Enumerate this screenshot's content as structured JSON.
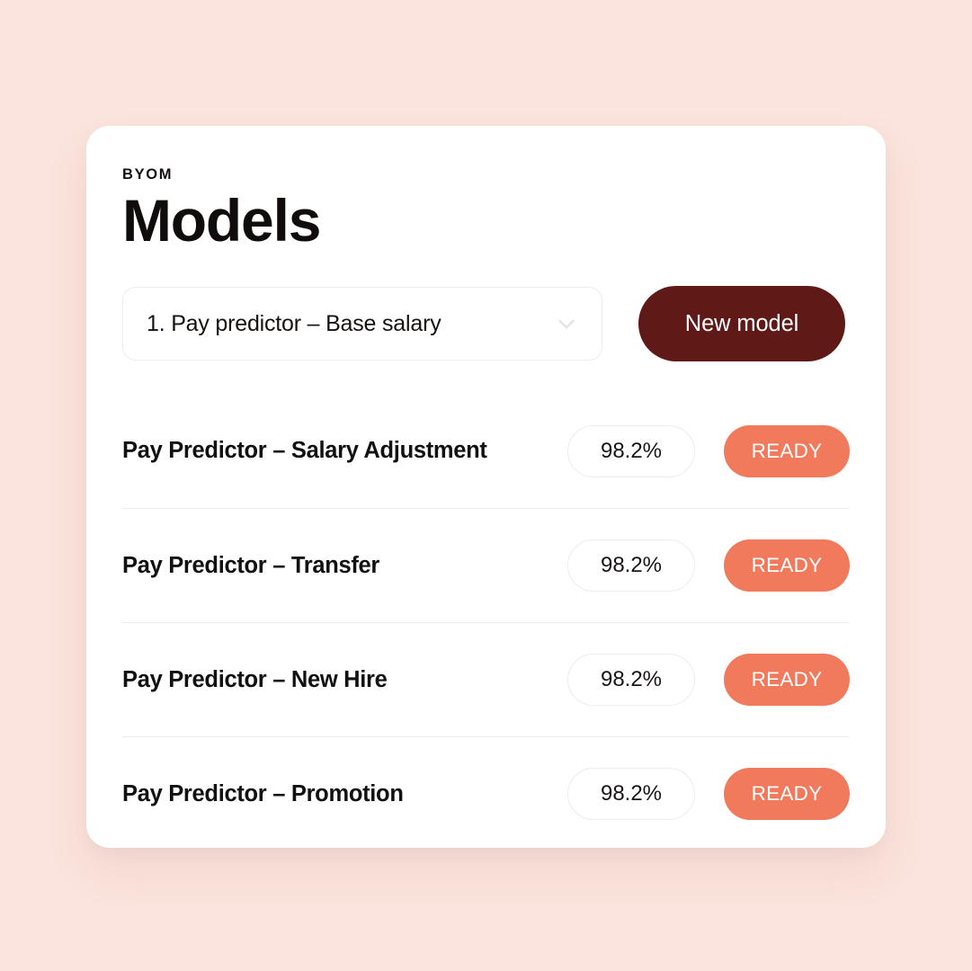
{
  "theme": {
    "page_background": "#FBE4DD",
    "card_background": "#FFFFFF",
    "primary_button": "#5F1A18",
    "status_ready": "#F1795C",
    "text_primary": "#131010",
    "divider": "#EFEFEF"
  },
  "card": {
    "eyebrow": "BYOM",
    "title": "Models"
  },
  "controls": {
    "model_select": {
      "value": "1. Pay predictor – Base salary",
      "icon": "chevron-down-icon"
    },
    "new_model_label": "New model"
  },
  "models": [
    {
      "name": "Pay Predictor – Salary Adjustment",
      "accuracy": "98.2%",
      "status": "READY"
    },
    {
      "name": "Pay Predictor – Transfer",
      "accuracy": "98.2%",
      "status": "READY"
    },
    {
      "name": "Pay Predictor – New Hire",
      "accuracy": "98.2%",
      "status": "READY"
    },
    {
      "name": "Pay Predictor – Promotion",
      "accuracy": "98.2%",
      "status": "READY"
    }
  ]
}
